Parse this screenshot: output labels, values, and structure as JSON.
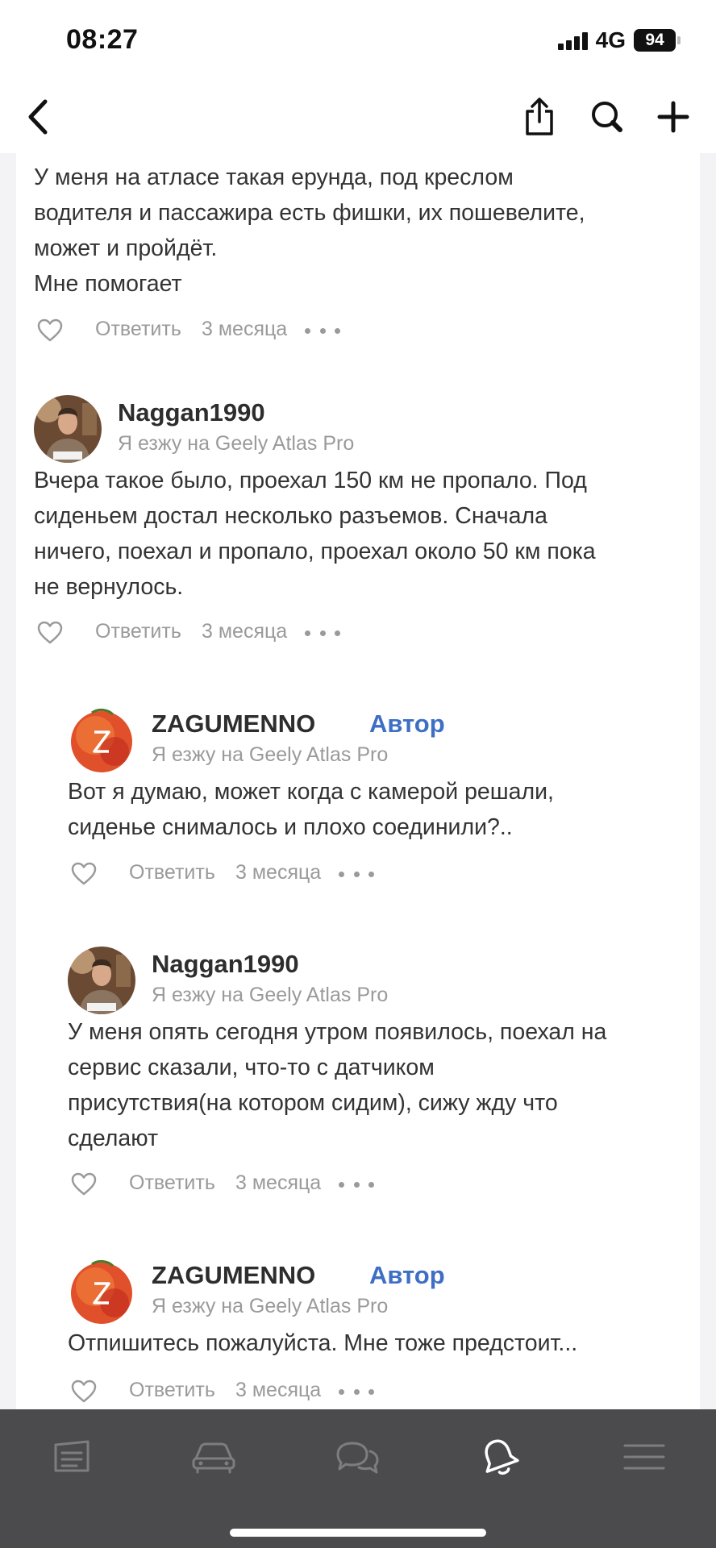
{
  "status_bar": {
    "time": "08:27",
    "network": "4G",
    "battery": "94"
  },
  "nav": {
    "back": "back-icon",
    "share": "share-icon",
    "search": "search-icon",
    "add": "plus-icon"
  },
  "comments": [
    {
      "text": "У меня на атласе такая ерунда, под креслом\nводителя и пассажира есть фишки, их пошевелите,\nможет и пройдёт.\nМне помогает",
      "reply_label": "Ответить",
      "time": "3 месяца"
    },
    {
      "username": "Naggan1990",
      "subtitle": "Я езжу на Geely Atlas Pro",
      "text": "Вчера такое было, проехал 150 км не пропало. Под\nсиденьем достал несколько разъемов. Сначала\nничего, поехал и пропало, проехал около 50 км пока\nне вернулось.",
      "reply_label": "Ответить",
      "time": "3 месяца"
    },
    {
      "username": "ZAGUMENNO",
      "badge": "Автор",
      "subtitle": "Я езжу на Geely Atlas Pro",
      "text": "Вот я думаю, может когда с камерой решали,\nсиденье снималось и плохо соединили?..",
      "reply_label": "Ответить",
      "time": "3 месяца"
    },
    {
      "username": "Naggan1990",
      "subtitle": "Я езжу на Geely Atlas Pro",
      "text": "У меня опять сегодня утром появилось, поехал на\nсервис сказали, что-то с датчиком\nприсутствия(на котором сидим), сижу жду что\nсделают",
      "reply_label": "Ответить",
      "time": "3 месяца"
    },
    {
      "username": "ZAGUMENNO",
      "badge": "Автор",
      "subtitle": "Я езжу на Geely Atlas Pro",
      "text": "Отпишитесь пожалуйста. Мне тоже предстоит...",
      "reply_label": "Ответить",
      "time": "3 месяца"
    }
  ],
  "tabs": [
    "journal-icon",
    "car-icon",
    "chat-icon",
    "notifications-icon",
    "menu-icon"
  ],
  "colors": {
    "author_badge": "#3f6fc4",
    "tab_bar": "#4b4b4d",
    "muted_text": "#9a9a9a"
  }
}
